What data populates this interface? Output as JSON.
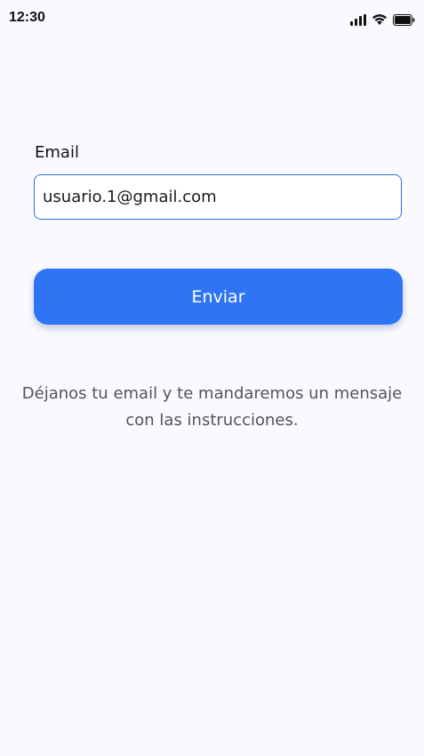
{
  "status_bar": {
    "time": "12:30",
    "icons": [
      "signal-icon",
      "wifi-icon",
      "battery-icon"
    ]
  },
  "form": {
    "email_label": "Email",
    "email_value": "usuario.1@gmail.com",
    "send_label": "Enviar",
    "info_text": "Déjanos tu email y te mandaremos un mensaje con las instrucciones."
  },
  "colors": {
    "accent": "#2f74f5",
    "input_border": "#2f6fe0",
    "background": "#f9f9fe",
    "muted_text": "#555555"
  }
}
